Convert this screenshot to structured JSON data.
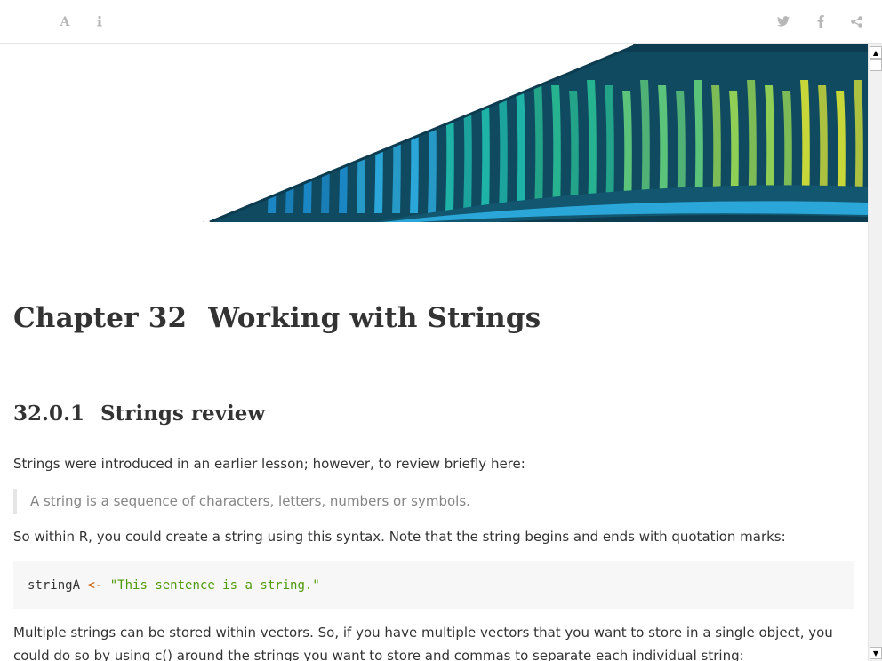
{
  "toolbar": {
    "left_icons": [
      "font-settings-icon",
      "info-icon"
    ],
    "right_icons": [
      "twitter-icon",
      "facebook-icon",
      "share-icon"
    ]
  },
  "chapter": {
    "number": "Chapter 32",
    "title": "Working with Strings"
  },
  "section": {
    "number": "32.0.1",
    "title": "Strings review"
  },
  "paragraphs": {
    "intro": "Strings were introduced in an earlier lesson; however, to review briefly here:",
    "quote": "A string is a sequence of characters, letters, numbers or symbols.",
    "syntax": "So within R, you could create a string using this syntax. Note that the string begins and ends with quotation marks:",
    "vectors": "Multiple strings can be stored within vectors. So, if you have multiple vectors that you want to store in a single object, you could do so by using c() around the strings you want to store and commas to separate each individual string:"
  },
  "code": {
    "variable": "stringA",
    "operator": "<-",
    "string": "\"This sentence is a string.\""
  },
  "colors": {
    "toolbar_icon": "#b7b7b7",
    "text": "#333333",
    "quote_text": "#858585",
    "code_bg": "#f7f7f7",
    "code_operator": "#ce5c00",
    "code_string": "#4e9a06",
    "banner_dark": "#0d3b4f"
  }
}
